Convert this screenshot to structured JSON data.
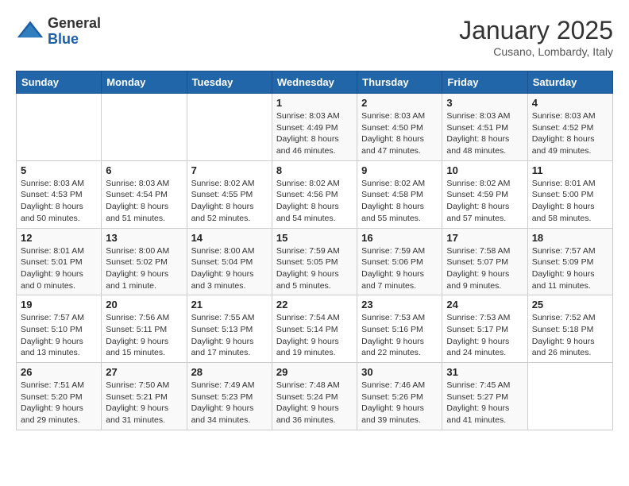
{
  "logo": {
    "line1": "General",
    "line2": "Blue"
  },
  "title": "January 2025",
  "location": "Cusano, Lombardy, Italy",
  "days_of_week": [
    "Sunday",
    "Monday",
    "Tuesday",
    "Wednesday",
    "Thursday",
    "Friday",
    "Saturday"
  ],
  "weeks": [
    [
      {
        "date": "",
        "info": ""
      },
      {
        "date": "",
        "info": ""
      },
      {
        "date": "",
        "info": ""
      },
      {
        "date": "1",
        "info": "Sunrise: 8:03 AM\nSunset: 4:49 PM\nDaylight: 8 hours and 46 minutes."
      },
      {
        "date": "2",
        "info": "Sunrise: 8:03 AM\nSunset: 4:50 PM\nDaylight: 8 hours and 47 minutes."
      },
      {
        "date": "3",
        "info": "Sunrise: 8:03 AM\nSunset: 4:51 PM\nDaylight: 8 hours and 48 minutes."
      },
      {
        "date": "4",
        "info": "Sunrise: 8:03 AM\nSunset: 4:52 PM\nDaylight: 8 hours and 49 minutes."
      }
    ],
    [
      {
        "date": "5",
        "info": "Sunrise: 8:03 AM\nSunset: 4:53 PM\nDaylight: 8 hours and 50 minutes."
      },
      {
        "date": "6",
        "info": "Sunrise: 8:03 AM\nSunset: 4:54 PM\nDaylight: 8 hours and 51 minutes."
      },
      {
        "date": "7",
        "info": "Sunrise: 8:02 AM\nSunset: 4:55 PM\nDaylight: 8 hours and 52 minutes."
      },
      {
        "date": "8",
        "info": "Sunrise: 8:02 AM\nSunset: 4:56 PM\nDaylight: 8 hours and 54 minutes."
      },
      {
        "date": "9",
        "info": "Sunrise: 8:02 AM\nSunset: 4:58 PM\nDaylight: 8 hours and 55 minutes."
      },
      {
        "date": "10",
        "info": "Sunrise: 8:02 AM\nSunset: 4:59 PM\nDaylight: 8 hours and 57 minutes."
      },
      {
        "date": "11",
        "info": "Sunrise: 8:01 AM\nSunset: 5:00 PM\nDaylight: 8 hours and 58 minutes."
      }
    ],
    [
      {
        "date": "12",
        "info": "Sunrise: 8:01 AM\nSunset: 5:01 PM\nDaylight: 9 hours and 0 minutes."
      },
      {
        "date": "13",
        "info": "Sunrise: 8:00 AM\nSunset: 5:02 PM\nDaylight: 9 hours and 1 minute."
      },
      {
        "date": "14",
        "info": "Sunrise: 8:00 AM\nSunset: 5:04 PM\nDaylight: 9 hours and 3 minutes."
      },
      {
        "date": "15",
        "info": "Sunrise: 7:59 AM\nSunset: 5:05 PM\nDaylight: 9 hours and 5 minutes."
      },
      {
        "date": "16",
        "info": "Sunrise: 7:59 AM\nSunset: 5:06 PM\nDaylight: 9 hours and 7 minutes."
      },
      {
        "date": "17",
        "info": "Sunrise: 7:58 AM\nSunset: 5:07 PM\nDaylight: 9 hours and 9 minutes."
      },
      {
        "date": "18",
        "info": "Sunrise: 7:57 AM\nSunset: 5:09 PM\nDaylight: 9 hours and 11 minutes."
      }
    ],
    [
      {
        "date": "19",
        "info": "Sunrise: 7:57 AM\nSunset: 5:10 PM\nDaylight: 9 hours and 13 minutes."
      },
      {
        "date": "20",
        "info": "Sunrise: 7:56 AM\nSunset: 5:11 PM\nDaylight: 9 hours and 15 minutes."
      },
      {
        "date": "21",
        "info": "Sunrise: 7:55 AM\nSunset: 5:13 PM\nDaylight: 9 hours and 17 minutes."
      },
      {
        "date": "22",
        "info": "Sunrise: 7:54 AM\nSunset: 5:14 PM\nDaylight: 9 hours and 19 minutes."
      },
      {
        "date": "23",
        "info": "Sunrise: 7:53 AM\nSunset: 5:16 PM\nDaylight: 9 hours and 22 minutes."
      },
      {
        "date": "24",
        "info": "Sunrise: 7:53 AM\nSunset: 5:17 PM\nDaylight: 9 hours and 24 minutes."
      },
      {
        "date": "25",
        "info": "Sunrise: 7:52 AM\nSunset: 5:18 PM\nDaylight: 9 hours and 26 minutes."
      }
    ],
    [
      {
        "date": "26",
        "info": "Sunrise: 7:51 AM\nSunset: 5:20 PM\nDaylight: 9 hours and 29 minutes."
      },
      {
        "date": "27",
        "info": "Sunrise: 7:50 AM\nSunset: 5:21 PM\nDaylight: 9 hours and 31 minutes."
      },
      {
        "date": "28",
        "info": "Sunrise: 7:49 AM\nSunset: 5:23 PM\nDaylight: 9 hours and 34 minutes."
      },
      {
        "date": "29",
        "info": "Sunrise: 7:48 AM\nSunset: 5:24 PM\nDaylight: 9 hours and 36 minutes."
      },
      {
        "date": "30",
        "info": "Sunrise: 7:46 AM\nSunset: 5:26 PM\nDaylight: 9 hours and 39 minutes."
      },
      {
        "date": "31",
        "info": "Sunrise: 7:45 AM\nSunset: 5:27 PM\nDaylight: 9 hours and 41 minutes."
      },
      {
        "date": "",
        "info": ""
      }
    ]
  ]
}
